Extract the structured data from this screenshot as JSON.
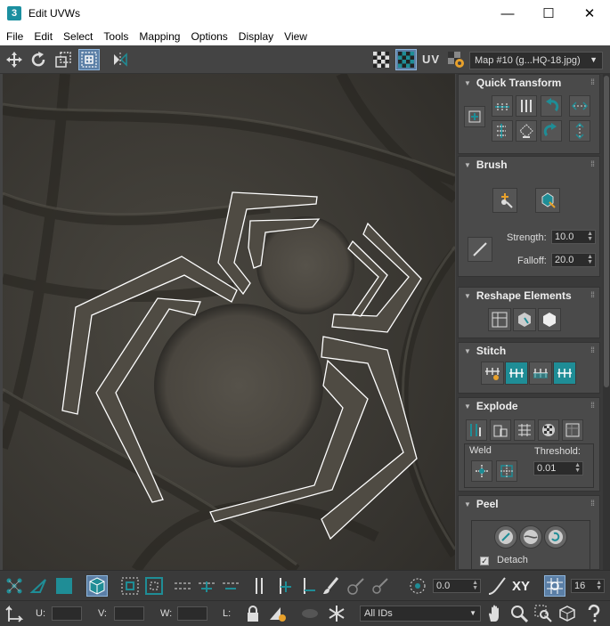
{
  "window": {
    "title": "Edit UVWs",
    "app_icon": "3",
    "controls": {
      "minimize": "—",
      "maximize": "☐",
      "close": "✕"
    }
  },
  "menu": [
    "File",
    "Edit",
    "Select",
    "Tools",
    "Mapping",
    "Options",
    "Display",
    "View"
  ],
  "toolbar": {
    "uv_label": "UV",
    "map_selector": "Map #10 (g...HQ-18.jpg)"
  },
  "rollouts": {
    "quick_transform": {
      "title": "Quick Transform"
    },
    "brush": {
      "title": "Brush",
      "strength_label": "Strength:",
      "strength_value": "10.0",
      "falloff_label": "Falloff:",
      "falloff_value": "20.0"
    },
    "reshape_elements": {
      "title": "Reshape Elements"
    },
    "stitch": {
      "title": "Stitch"
    },
    "explode": {
      "title": "Explode",
      "weld_label": "Weld",
      "threshold_label": "Threshold:",
      "threshold_value": "0.01"
    },
    "peel": {
      "title": "Peel",
      "detach_label": "Detach",
      "detach_checked": true
    }
  },
  "bottom_toolbar": {
    "angle_value": "0.0",
    "xy_label": "XY",
    "grid_value": "16",
    "u_label": "U:",
    "v_label": "V:",
    "w_label": "W:",
    "l_label": "L:",
    "u_value": "",
    "v_value": "",
    "w_value": "",
    "filter_select": "All IDs"
  },
  "colors": {
    "accent_teal": "#1f8d96",
    "active_blue": "#5b7fa6",
    "panel_bg": "#4a4a4a",
    "uv_edge": "#ffffff"
  }
}
